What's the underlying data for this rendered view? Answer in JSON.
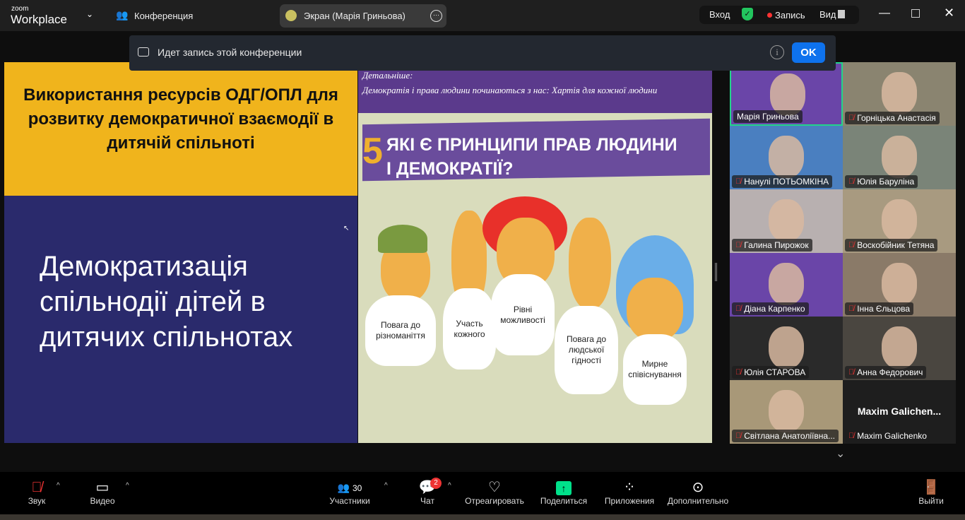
{
  "app": {
    "logo_small": "zoom",
    "logo_big": "Workplace",
    "meeting_label": "Конференция",
    "screen_share": "Экран (Марія Гриньова)",
    "login": "Вход",
    "recording": "Запись",
    "view": "Вид"
  },
  "notice": {
    "text": "Идет запись этой конференции",
    "ok": "OK"
  },
  "slide": {
    "left_title": "Використання ресурсів ОДГ/ОПЛ для розвитку демократичної взаємодії в дитячій спільноті",
    "left_subtitle": "Демократизація спільнодії дітей в дитячих спільнотах",
    "right_more": "Детальніше:",
    "right_link": "Демократія  і права людини починаються з нас:  Хартія для кожної людини",
    "number": "5",
    "heading_line1": "ЯКІ Є ПРИНЦИПИ ПРАВ ЛЮДИНИ",
    "heading_line2": "І ДЕМОКРАТІЇ?",
    "principles": [
      "Повага до різноманіття",
      "Участь кожного",
      "Рівні можливості",
      "Повага до людської гідності",
      "Мирне співіснування"
    ]
  },
  "participants": [
    {
      "name": "Марія Гриньова",
      "muted": false,
      "active": true,
      "color": "#6a45a8"
    },
    {
      "name": "Горніцька Анастасія",
      "muted": true,
      "color": "#8a8470"
    },
    {
      "name": "Нанулі ПОТЬОМКІНА",
      "muted": true,
      "color": "#4a7fc0"
    },
    {
      "name": "Юлія Баруліна",
      "muted": true,
      "color": "#7a8478"
    },
    {
      "name": "Галина Пирожок",
      "muted": true,
      "color": "#b8b0b0"
    },
    {
      "name": "Воскобійник Тетяна",
      "muted": true,
      "color": "#a89a80"
    },
    {
      "name": "Діана Карпенко",
      "muted": true,
      "color": "#6a45a8"
    },
    {
      "name": "Інна  Єльцова",
      "muted": true,
      "color": "#8a7a68"
    },
    {
      "name": "Юлія СТАРОВА",
      "muted": true,
      "color": "#2a2a2a"
    },
    {
      "name": "Анна Федорович",
      "muted": true,
      "color": "#4a4640"
    },
    {
      "name": "Світлана Анатоліївна...",
      "muted": true,
      "color": "#a89878"
    },
    {
      "name": "Maxim Galichenko",
      "muted": true,
      "color": "#1e1e1e",
      "display": "Maxim  Galichen..."
    }
  ],
  "toolbar": {
    "audio": "Звук",
    "video": "Видео",
    "participants": "Участники",
    "participants_count": "30",
    "chat": "Чат",
    "chat_badge": "2",
    "react": "Отреагировать",
    "share": "Поделиться",
    "apps": "Приложения",
    "more": "Дополнительно",
    "leave": "Выйти"
  },
  "colors": {
    "accent": "#0e72ed",
    "share": "#00e08a",
    "active_border": "#22d48a",
    "mute": "#e02828"
  }
}
